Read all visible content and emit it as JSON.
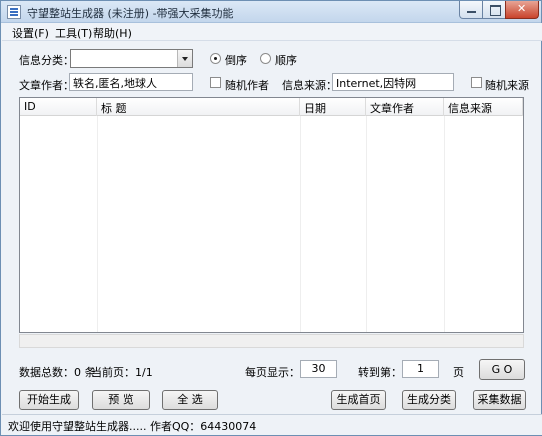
{
  "window": {
    "title": "守望整站生成器 (未注册) -带强大采集功能"
  },
  "menubar": {
    "items": [
      "设置(F)",
      "工具(T)",
      "帮助(H)"
    ]
  },
  "form": {
    "category_label": "信息分类：",
    "category_value": "",
    "order_desc_label": "倒序",
    "order_asc_label": "顺序",
    "order_selected": "倒序",
    "author_label": "文章作者：",
    "author_value": "轶名,匿名,地球人",
    "random_author_label": "随机作者",
    "source_label": "信息来源：",
    "source_value": "Internet,因特网",
    "random_source_label": "随机来源"
  },
  "table": {
    "columns": [
      "ID",
      "标  题",
      "日期",
      "文章作者",
      "信息来源"
    ],
    "rows": []
  },
  "pager": {
    "total_text": "数据总数：0 条",
    "current_page_text": "当前页：1/1",
    "per_page_label": "每页显示：",
    "per_page_value": "30",
    "goto_label": "转到第：",
    "goto_value": "1",
    "page_unit": "页",
    "go_label": "G O"
  },
  "actions": {
    "start": "开始生成",
    "preview": "预  览",
    "select_all": "全  选",
    "gen_home": "生成首页",
    "gen_category": "生成分类",
    "collect": "采集数据"
  },
  "status": {
    "text": "欢迎使用守望整站生成器..... 作者QQ：64430074"
  }
}
